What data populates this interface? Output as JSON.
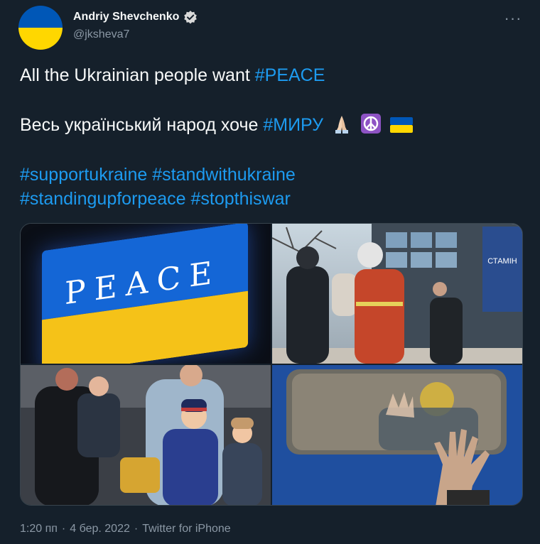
{
  "author": {
    "display_name": "Andriy Shevchenko",
    "handle": "@jksheva7",
    "verified": true
  },
  "menu": {
    "more_label": "···"
  },
  "tweet": {
    "line1_text": "All the Ukrainian people want ",
    "line1_tag": "#PEACE",
    "line2_text": "Весь український народ хоче ",
    "line2_tag": "#МИРУ",
    "emojis": [
      "folded-hands",
      "peace-symbol",
      "ukraine-flag"
    ],
    "hashtags": [
      "#supportukraine",
      "#standwithukraine",
      "#standingupforpeace",
      "#stopthiswar"
    ]
  },
  "media": {
    "photo1_text": "PEACE",
    "photo2_sign": "СТАМІН"
  },
  "footer": {
    "time": "1:20 пп",
    "sep": "·",
    "date": "4 бер. 2022",
    "source": "Twitter for iPhone"
  },
  "colors": {
    "background": "#15202b",
    "link": "#1d9bf0",
    "muted": "#8b98a5",
    "flag_blue": "#0057b7",
    "flag_yellow": "#ffd700"
  }
}
